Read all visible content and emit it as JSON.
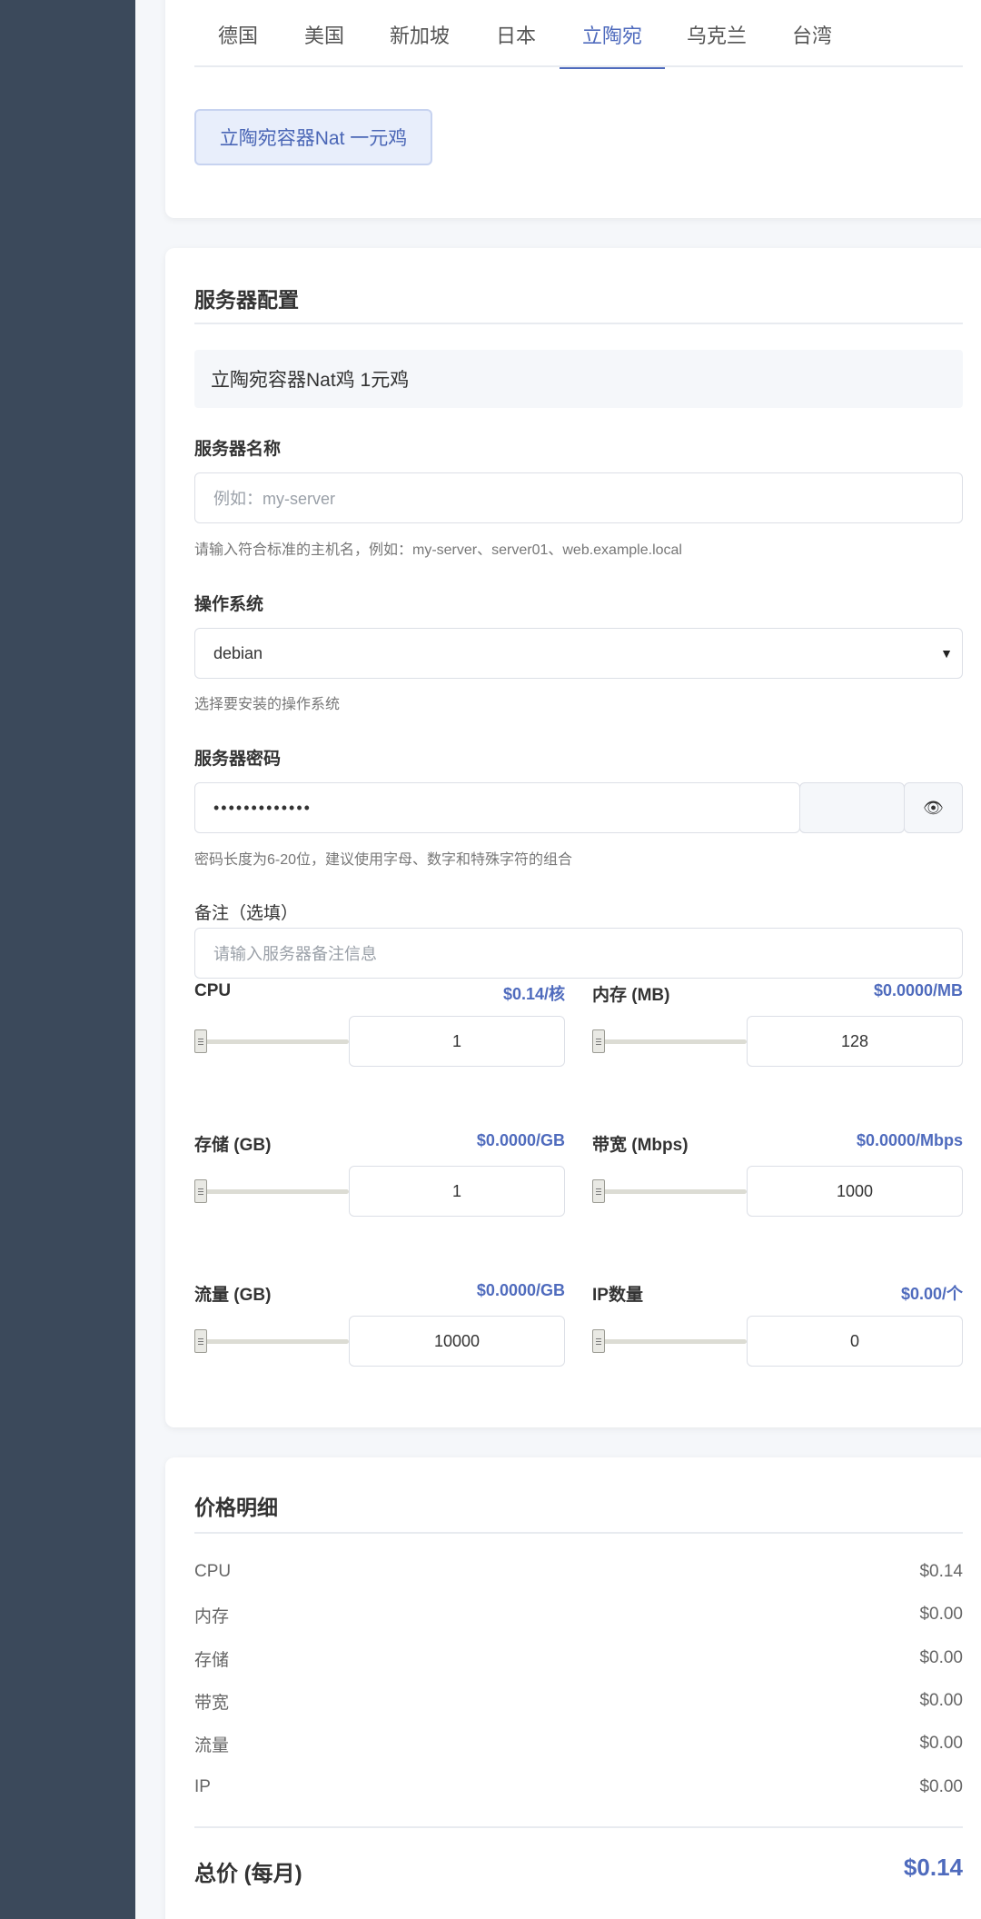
{
  "regions": {
    "tabs": [
      {
        "label": "德国"
      },
      {
        "label": "美国"
      },
      {
        "label": "新加坡"
      },
      {
        "label": "日本"
      },
      {
        "label": "立陶宛"
      },
      {
        "label": "乌克兰"
      },
      {
        "label": "台湾"
      }
    ],
    "active_tab": "立陶宛",
    "plan_chip": "立陶宛容器Nat 一元鸡"
  },
  "config": {
    "title": "服务器配置",
    "selected_plan": "立陶宛容器Nat鸡 1元鸡",
    "server_name": {
      "label": "服务器名称",
      "placeholder": "例如：my-server",
      "hint": "请输入符合标准的主机名，例如：my-server、server01、web.example.local"
    },
    "os": {
      "label": "操作系统",
      "value": "debian",
      "hint": "选择要安装的操作系统"
    },
    "password": {
      "label": "服务器密码",
      "value": "•••••••••••••",
      "hint": "密码长度为6-20位，建议使用字母、数字和特殊字符的组合"
    },
    "note": {
      "label": "备注（选填）",
      "placeholder": "请输入服务器备注信息"
    },
    "resources": [
      {
        "label": "CPU",
        "price": "$0.14/核",
        "value": "1"
      },
      {
        "label": "内存 (MB)",
        "price": "$0.0000/MB",
        "value": "128"
      },
      {
        "label": "存储 (GB)",
        "price": "$0.0000/GB",
        "value": "1"
      },
      {
        "label": "带宽 (Mbps)",
        "price": "$0.0000/Mbps",
        "value": "1000"
      },
      {
        "label": "流量 (GB)",
        "price": "$0.0000/GB",
        "value": "10000"
      },
      {
        "label": "IP数量",
        "price": "$0.00/个",
        "value": "0"
      }
    ]
  },
  "price": {
    "title": "价格明细",
    "rows": [
      {
        "label": "CPU",
        "value": "$0.14"
      },
      {
        "label": "内存",
        "value": "$0.00"
      },
      {
        "label": "存储",
        "value": "$0.00"
      },
      {
        "label": "带宽",
        "value": "$0.00"
      },
      {
        "label": "流量",
        "value": "$0.00"
      },
      {
        "label": "IP",
        "value": "$0.00"
      }
    ],
    "total_label": "总价 (每月)",
    "total_value": "$0.14"
  },
  "icons": {
    "eye": "eye-icon",
    "select_arrow": "caret-down-icon"
  },
  "colors": {
    "accent": "#4f6bbd",
    "sidebar": "#3b495b"
  }
}
